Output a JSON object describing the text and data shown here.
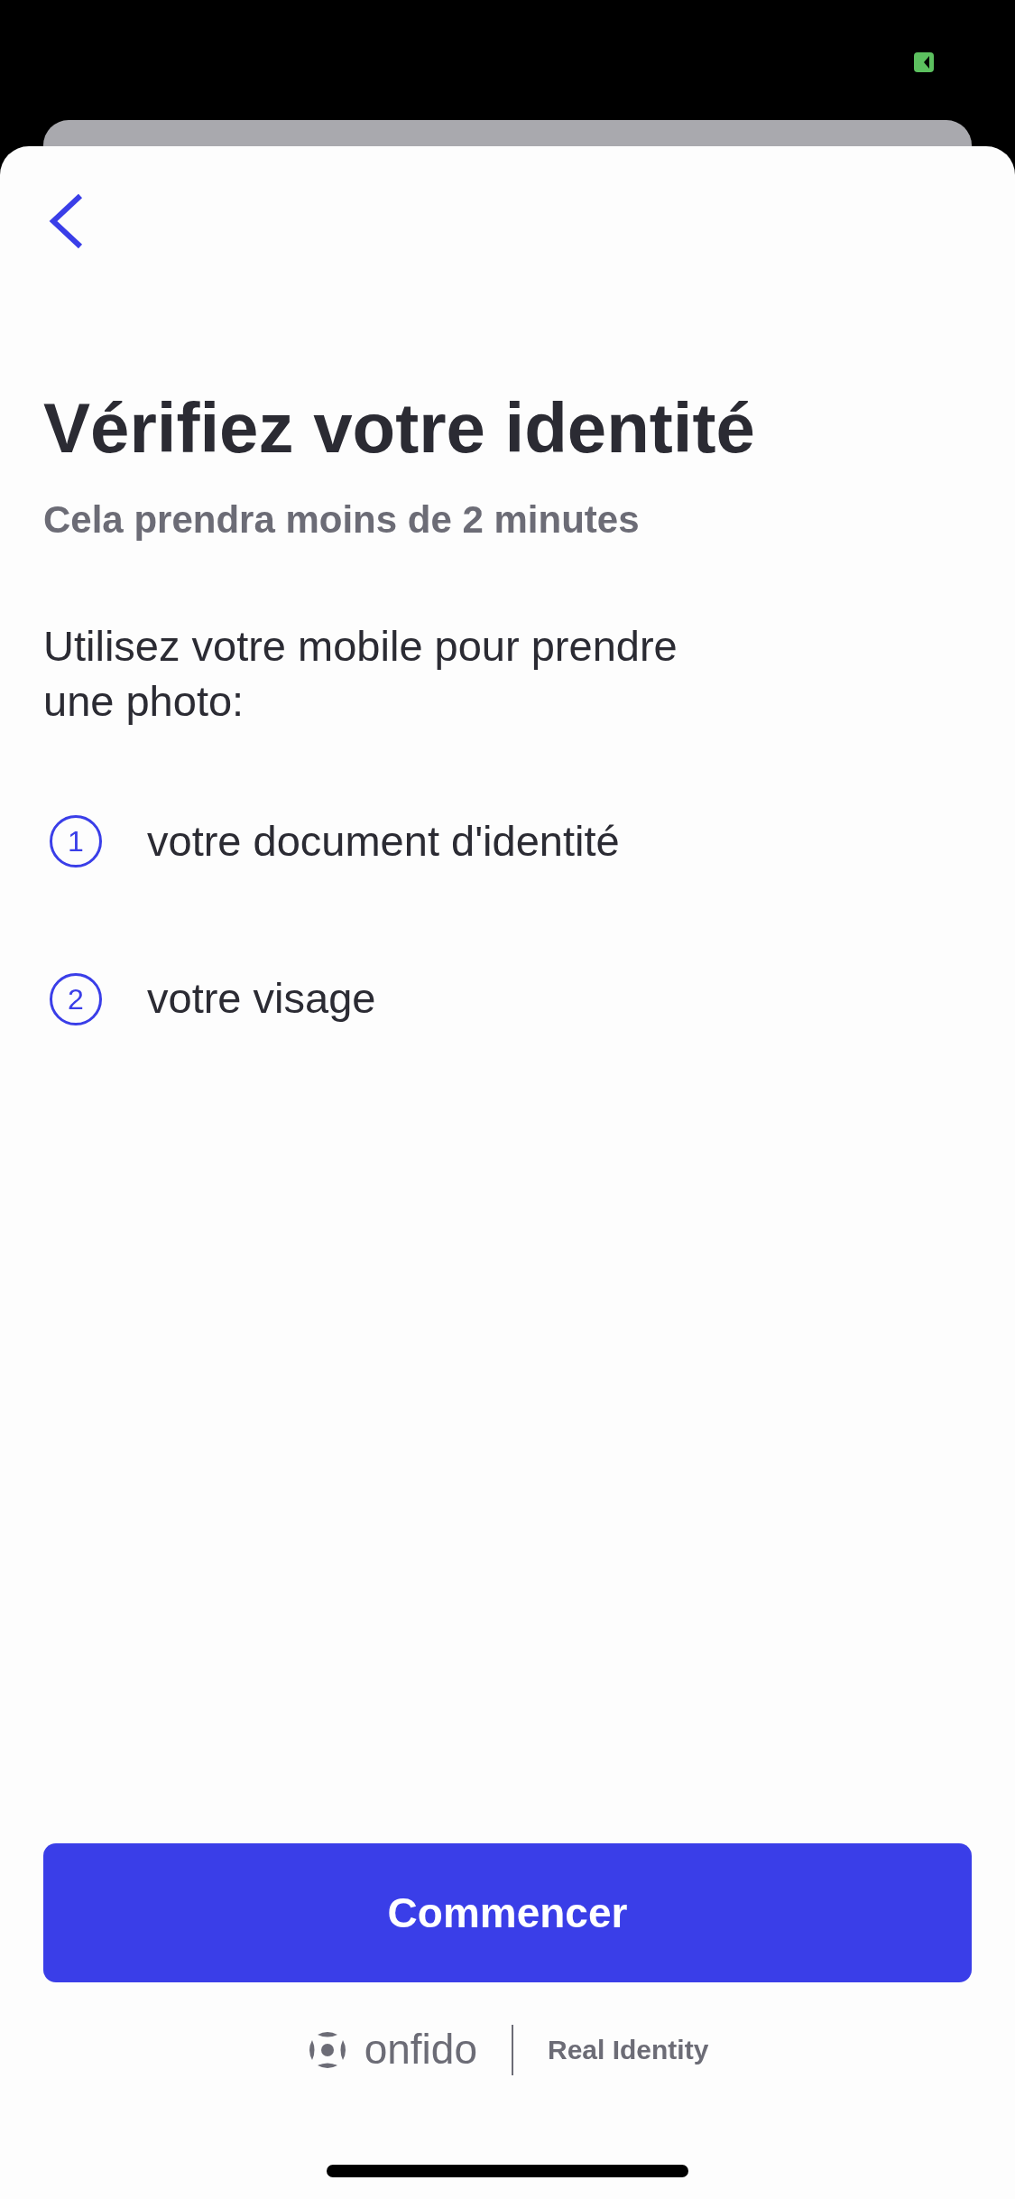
{
  "screen": {
    "title": "Vérifiez votre identité",
    "subtitle": "Cela prendra moins de 2 minutes",
    "intro": "Utilisez votre mobile pour prendre une photo:"
  },
  "steps": [
    {
      "number": "1",
      "label": "votre document d'identité"
    },
    {
      "number": "2",
      "label": "votre visage"
    }
  ],
  "primary_button": "Commencer",
  "footer": {
    "brand": "onfido",
    "tagline": "Real Identity"
  }
}
